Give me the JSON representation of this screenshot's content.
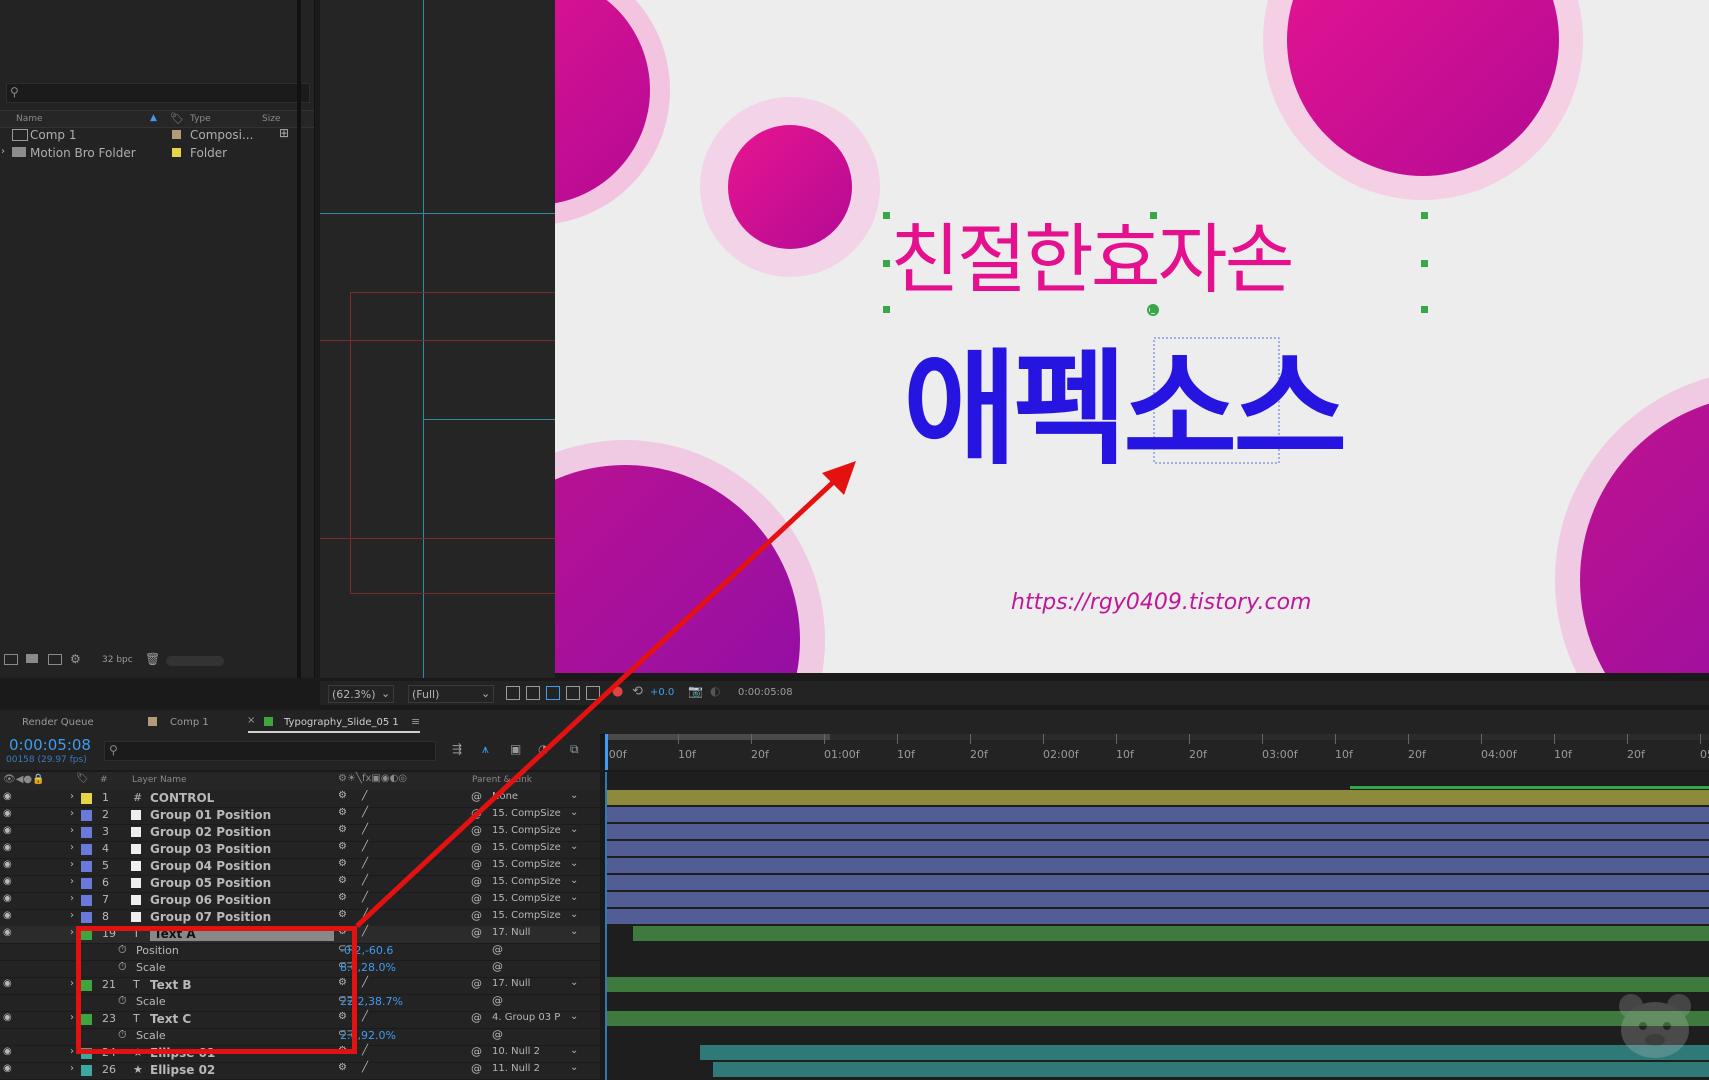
{
  "project": {
    "columns": {
      "name": "Name",
      "type": "Type",
      "size": "Size"
    },
    "items": [
      {
        "name": "Comp 1",
        "type": "Composi...",
        "color": "#b39b7a"
      },
      {
        "name": "Motion Bro Folder",
        "type": "Folder",
        "color": "#e6d548"
      }
    ],
    "bit_depth": "32 bpc"
  },
  "viewer": {
    "zoom": "(62.3%)",
    "resolution": "(Full)",
    "exposure": "+0.0",
    "timecode": "0:00:05:08"
  },
  "canvas": {
    "line1": "친절한효자손",
    "line2": "애펙소스",
    "url": "https://rgy0409.tistory.com",
    "colors": {
      "pink": "#e4108e",
      "blue": "#2614e0",
      "circle": "#d3108a"
    }
  },
  "timeline": {
    "tabs": [
      "Render Queue",
      "Comp 1",
      "Typography_Slide_05 1"
    ],
    "current_time": "0:00:05:08",
    "frames_info": "00158 (29.97 fps)",
    "col_layer_name": "Layer Name",
    "col_parent": "Parent & Link",
    "ruler_labels": [
      ":00f",
      "10f",
      "20f",
      "01:00f",
      "10f",
      "20f",
      "02:00f",
      "10f",
      "20f",
      "03:00f",
      "10f",
      "20f",
      "04:00f",
      "10f",
      "20f",
      "05"
    ],
    "layers": [
      {
        "num": "1",
        "name": "CONTROL",
        "type": "#",
        "color": "#e6d548",
        "parent": "None"
      },
      {
        "num": "2",
        "name": "Group 01 Position",
        "type": "",
        "color": "#6a7ad8",
        "parent": "15. CompSize"
      },
      {
        "num": "3",
        "name": "Group 02 Position",
        "type": "",
        "color": "#6a7ad8",
        "parent": "15. CompSize"
      },
      {
        "num": "4",
        "name": "Group 03 Position",
        "type": "",
        "color": "#6a7ad8",
        "parent": "15. CompSize"
      },
      {
        "num": "5",
        "name": "Group 04 Position",
        "type": "",
        "color": "#6a7ad8",
        "parent": "15. CompSize"
      },
      {
        "num": "6",
        "name": "Group 05 Position",
        "type": "",
        "color": "#6a7ad8",
        "parent": "15. CompSize"
      },
      {
        "num": "7",
        "name": "Group 06 Position",
        "type": "",
        "color": "#6a7ad8",
        "parent": "15. CompSize"
      },
      {
        "num": "8",
        "name": "Group 07 Position",
        "type": "",
        "color": "#6a7ad8",
        "parent": "15. CompSize"
      },
      {
        "num": "19",
        "name": "Text A",
        "type": "T",
        "color": "#3fa63f",
        "parent": "17. Null"
      },
      {
        "prop": "Position",
        "value": "-0.2,-60.6"
      },
      {
        "prop": "Scale",
        "value": "8.6,28.0%"
      },
      {
        "num": "21",
        "name": "Text B",
        "type": "T",
        "color": "#3fa63f",
        "parent": "17. Null"
      },
      {
        "prop": "Scale",
        "value": "22.2,38.7%"
      },
      {
        "num": "23",
        "name": "Text C",
        "type": "T",
        "color": "#3fa63f",
        "parent": "4. Group 03 P"
      },
      {
        "prop": "Scale",
        "value": "2.0,92.0%"
      },
      {
        "num": "24",
        "name": "Ellipse 01",
        "type": "★",
        "color": "#3fa6a0",
        "parent": "10. Null 2"
      },
      {
        "num": "26",
        "name": "Ellipse 02",
        "type": "★",
        "color": "#3fa6a0",
        "parent": "11. Null 2"
      }
    ]
  }
}
